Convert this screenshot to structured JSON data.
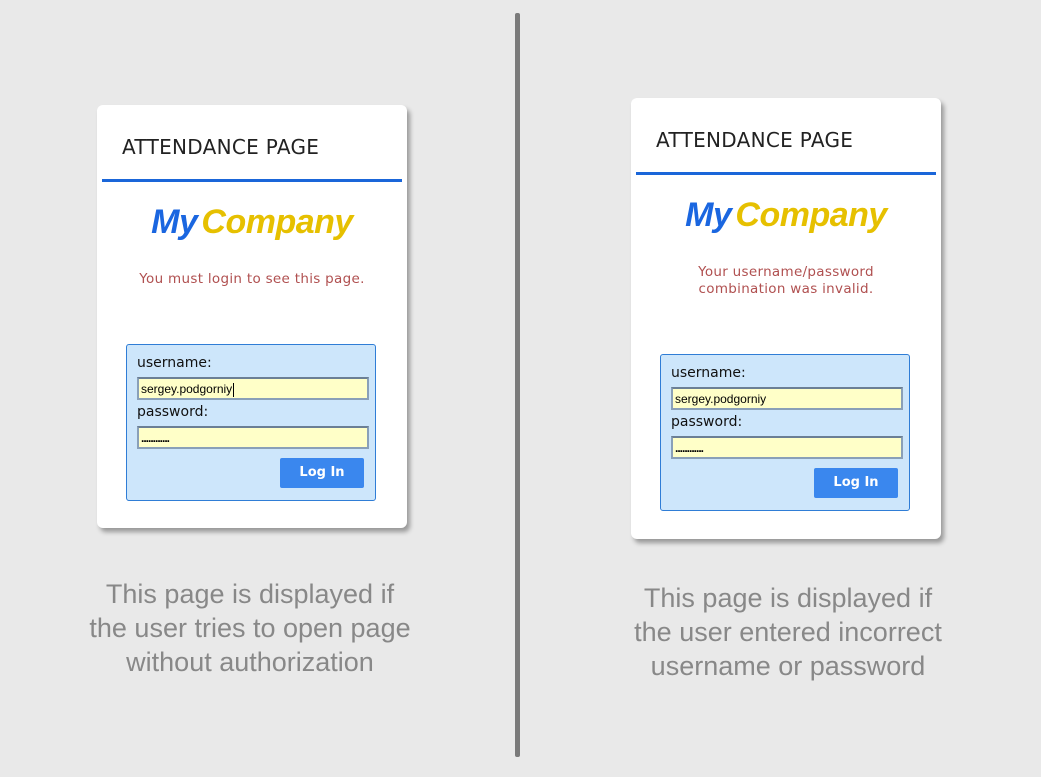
{
  "left_panel": {
    "title": "ATTENDANCE PAGE",
    "logo": {
      "my": "My",
      "company": "Company"
    },
    "message": "You must login to see this page.",
    "username_label": "username:",
    "username_value": "sergey.podgorniy",
    "password_label": "password:",
    "password_value": "............",
    "login_label": "Log In",
    "caption_lines": [
      "This page is displayed if",
      "the user tries to open page",
      "without authorization"
    ]
  },
  "right_panel": {
    "title": "ATTENDANCE PAGE",
    "logo": {
      "my": "My",
      "company": "Company"
    },
    "message_lines": [
      "Your username/password",
      "combination was invalid."
    ],
    "username_label": "username:",
    "username_value": "sergey.podgorniy",
    "password_label": "password:",
    "password_value": "............",
    "login_label": "Log In",
    "caption_lines": [
      "This page is displayed if",
      "the user entered incorrect",
      "username or password"
    ]
  },
  "colors": {
    "accent_blue": "#1a66d9",
    "logo_blue": "#1a66e0",
    "logo_yellow": "#e6c000",
    "error_text": "#b05050",
    "input_bg": "#ffffc8",
    "login_box_bg": "#cde6fb",
    "button_bg": "#3a87ee"
  }
}
